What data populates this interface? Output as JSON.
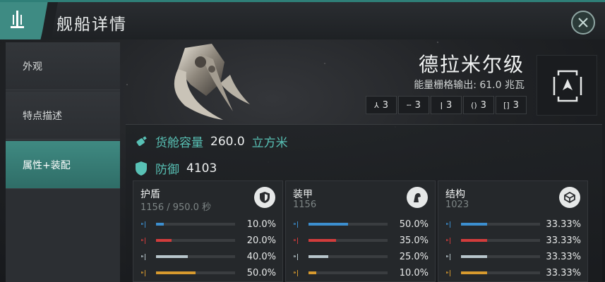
{
  "header": {
    "title": "舰船详情"
  },
  "sidebar": {
    "items": [
      {
        "label": "外观"
      },
      {
        "label": "特点描述"
      },
      {
        "label": "属性+装配",
        "active": true
      }
    ]
  },
  "ship": {
    "name": "德拉米尔级",
    "powergrid_label": "能量栅格输出: 61.0 兆瓦",
    "hardpoints": [
      {
        "icon": "turret-icon",
        "glyph": "⅄",
        "count": "3"
      },
      {
        "icon": "launcher-icon",
        "glyph": "╌",
        "count": "3"
      },
      {
        "icon": "high-slot-icon",
        "glyph": "ǀ",
        "count": "3"
      },
      {
        "icon": "mid-slot-icon",
        "glyph": "()",
        "count": "3"
      },
      {
        "icon": "low-slot-icon",
        "glyph": "[]",
        "count": "3"
      }
    ]
  },
  "cargo": {
    "label": "货舱容量",
    "value": "260.0",
    "unit": "立方米"
  },
  "defense": {
    "label": "防御",
    "value": "4103"
  },
  "colors": {
    "accent": "#3e8b83",
    "em": "#3c8fd0",
    "thermal": "#d23c3c",
    "kinetic": "#b8c6cc",
    "explosive": "#d79a2e"
  },
  "layers": [
    {
      "title": "护盾",
      "hp": "1156 / 950.0 秒",
      "icon": "shield-icon",
      "resists": [
        {
          "type": "em",
          "value": "10.0%",
          "fraction": 0.1
        },
        {
          "type": "thermal",
          "value": "20.0%",
          "fraction": 0.2
        },
        {
          "type": "kinetic",
          "value": "40.0%",
          "fraction": 0.4
        },
        {
          "type": "explosive",
          "value": "50.0%",
          "fraction": 0.5
        }
      ]
    },
    {
      "title": "装甲",
      "hp": "1156",
      "icon": "armor-icon",
      "resists": [
        {
          "type": "em",
          "value": "50.0%",
          "fraction": 0.5
        },
        {
          "type": "thermal",
          "value": "35.0%",
          "fraction": 0.35
        },
        {
          "type": "kinetic",
          "value": "25.0%",
          "fraction": 0.25
        },
        {
          "type": "explosive",
          "value": "10.0%",
          "fraction": 0.1
        }
      ]
    },
    {
      "title": "结构",
      "hp": "1023",
      "icon": "structure-icon",
      "resists": [
        {
          "type": "em",
          "value": "33.33%",
          "fraction": 0.3333
        },
        {
          "type": "thermal",
          "value": "33.33%",
          "fraction": 0.3333
        },
        {
          "type": "kinetic",
          "value": "33.33%",
          "fraction": 0.3333
        },
        {
          "type": "explosive",
          "value": "33.33%",
          "fraction": 0.3333
        }
      ]
    }
  ]
}
